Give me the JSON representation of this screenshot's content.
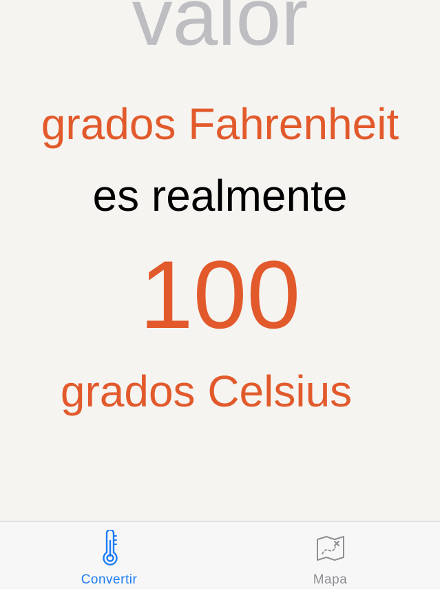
{
  "converter": {
    "input_placeholder": "valor",
    "input_value": "",
    "from_unit_label": "grados Fahrenheit",
    "connector_text": "es realmente",
    "result_value": "100",
    "to_unit_label": "grados Celsius"
  },
  "tab_bar": {
    "tabs": [
      {
        "label": "Convertir",
        "icon": "thermometer-icon",
        "selected": true
      },
      {
        "label": "Mapa",
        "icon": "map-icon",
        "selected": false
      }
    ]
  },
  "colors": {
    "accent": "#e25a2c",
    "placeholder": "#bdbdc2",
    "tab_selected": "#1a7cf4",
    "tab_unselected": "#8e8e93",
    "background": "#f5f4f1"
  }
}
